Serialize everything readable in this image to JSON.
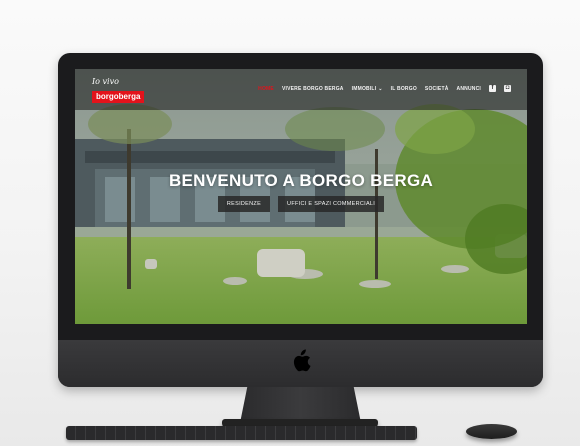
{
  "site": {
    "logo_script": "Io vivo",
    "logo_brand": "borgoberga",
    "accent_color": "#e3131b"
  },
  "nav": {
    "items": [
      {
        "label": "HOME",
        "active": true
      },
      {
        "label": "VIVERE BORGO BERGA"
      },
      {
        "label": "IMMOBILI",
        "dropdown": true
      },
      {
        "label": "IL BORGO"
      },
      {
        "label": "SOCIETÀ"
      },
      {
        "label": "ANNUNCI"
      }
    ],
    "social_icons": [
      "facebook-icon",
      "instagram-icon"
    ]
  },
  "hero": {
    "title": "BENVENUTO A BORGO BERGA",
    "buttons": [
      "RESIDENZE",
      "UFFICI E SPAZI COMMERCIALI"
    ]
  }
}
